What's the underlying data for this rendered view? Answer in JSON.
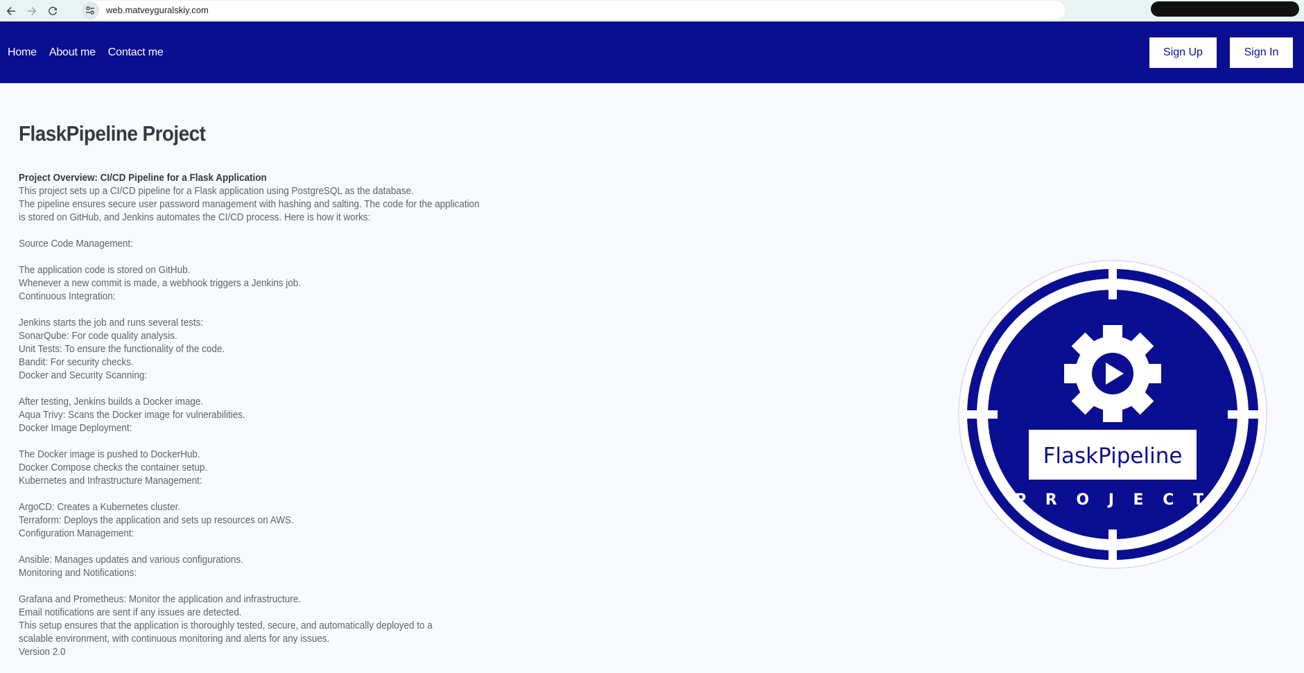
{
  "browser": {
    "url": "web.matveyguralskiy.com"
  },
  "header": {
    "nav": [
      "Home",
      "About me",
      "Contact me"
    ],
    "signup_label": "Sign Up",
    "signin_label": "Sign In",
    "background": "#0a0e90"
  },
  "main": {
    "title": "FlaskPipeline Project",
    "lines": [
      "Project Overview: CI/CD Pipeline for a Flask Application",
      "This project sets up a CI/CD pipeline for a Flask application using PostgreSQL as the database.",
      "The pipeline ensures secure user password management with hashing and salting. The code for the application",
      "is stored on GitHub, and Jenkins automates the CI/CD process. Here is how it works:",
      "",
      "Source Code Management:",
      "",
      "The application code is stored on GitHub.",
      "Whenever a new commit is made, a webhook triggers a Jenkins job.",
      "Continuous Integration:",
      "",
      "Jenkins starts the job and runs several tests:",
      "SonarQube: For code quality analysis.",
      "Unit Tests: To ensure the functionality of the code.",
      "Bandit: For security checks.",
      "Docker and Security Scanning:",
      "",
      "After testing, Jenkins builds a Docker image.",
      "Aqua Trivy: Scans the Docker image for vulnerabilities.",
      "Docker Image Deployment:",
      "",
      "The Docker image is pushed to DockerHub.",
      "Docker Compose checks the container setup.",
      "Kubernetes and Infrastructure Management:",
      "",
      "ArgoCD: Creates a Kubernetes cluster.",
      "Terraform: Deploys the application and sets up resources on AWS.",
      "Configuration Management:",
      "",
      "Ansible: Manages updates and various configurations.",
      "Monitoring and Notifications:",
      "",
      "Grafana and Prometheus: Monitor the application and infrastructure.",
      "Email notifications are sent if any issues are detected.",
      "This setup ensures that the application is thoroughly tested, secure, and automatically deployed to a",
      "scalable environment, with continuous monitoring and alerts for any issues.",
      "Version 2.0"
    ]
  },
  "logo": {
    "name": "FlaskPipeline",
    "sub": "P R O J E C T",
    "color": "#0a0e90"
  }
}
